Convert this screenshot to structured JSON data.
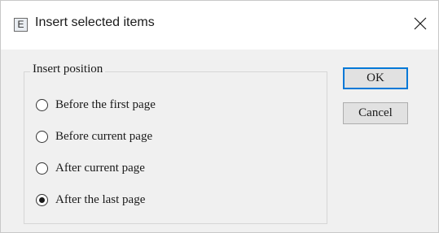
{
  "window": {
    "title": "Insert selected items",
    "icon_letter": "E",
    "close_glyph": "close-icon"
  },
  "group": {
    "legend": "Insert position",
    "options": [
      {
        "label": "Before the first page",
        "checked": false
      },
      {
        "label": "Before current page",
        "checked": false
      },
      {
        "label": "After current page",
        "checked": false
      },
      {
        "label": "After the last page",
        "checked": true
      }
    ]
  },
  "buttons": {
    "ok": "OK",
    "cancel": "Cancel"
  },
  "colors": {
    "accent": "#0078d7",
    "dialog_bg": "#f0f0f0",
    "titlebar_bg": "#ffffff"
  }
}
